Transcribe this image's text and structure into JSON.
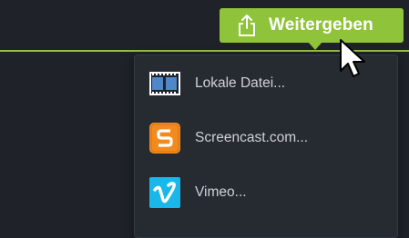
{
  "header": {
    "share_button": {
      "label": "Weitergeben",
      "icon": "share-upload-icon"
    }
  },
  "share_menu": {
    "items": [
      {
        "label": "Lokale Datei...",
        "icon": "film-strip-icon"
      },
      {
        "label": "Screencast.com...",
        "icon": "screencast-logo-icon"
      },
      {
        "label": "Vimeo...",
        "icon": "vimeo-logo-icon"
      }
    ]
  },
  "colors": {
    "accent": "#8fc33a",
    "background": "#1f2329",
    "menu_background": "#262a31",
    "screencast_orange": "#f28b1e",
    "vimeo_blue": "#1ab7ea"
  }
}
